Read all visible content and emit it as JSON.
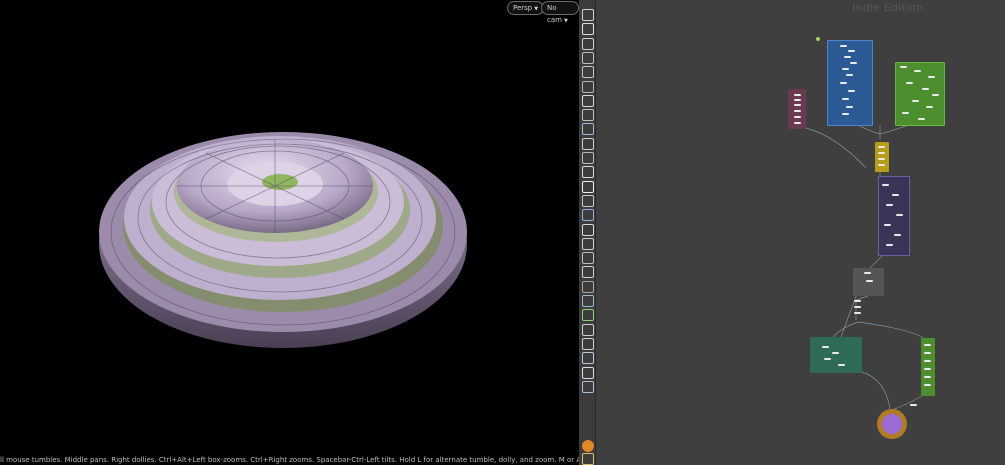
{
  "viewport": {
    "camera_menu": "Persp",
    "cam_menu": "No cam",
    "status_text": "ll mouse tumbles. Middle pans. Right dollies. Ctrl+Alt+Left box-zooms. Ctrl+Right zooms. Spacebar-Ctrl-Left tilts. Hold L for alternate tumble, dolly, and zoom.     M or Alt+M for First Person"
  },
  "toolbar": {
    "icons": [
      "view-icon",
      "display-options-icon",
      "lock-icon",
      "light-icon",
      "shading-icon",
      "ghost-icon",
      "point-light-icon",
      "camera-icon",
      "render-icon",
      "snap-icon",
      "grid-icon",
      "scale-icon",
      "point-icon",
      "handle-icon",
      "select-icon",
      "stats-icon",
      "transform-icon",
      "geometry-icon",
      "group-icon",
      "vertex-icon",
      "mesh-icon",
      "material-icon",
      "color-icon",
      "uv-icon",
      "lighting-icon",
      "box-icon",
      "camera-view-icon",
      "help-icon",
      "layout-icon"
    ]
  },
  "network": {
    "watermark": "Indie Edition",
    "colors": {
      "blue": "#2c5a95",
      "green": "#4d8f2e",
      "yellow": "#b89d1a",
      "teal": "#2f6a58",
      "purple": "#9b6bd6",
      "orange": "#b07a26",
      "pink": "#6b3a52"
    }
  }
}
